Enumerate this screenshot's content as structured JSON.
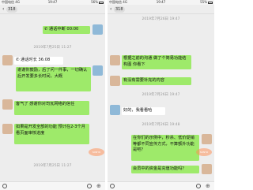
{
  "left": {
    "status": {
      "carrier": "中国电信 4G",
      "time": "19:47",
      "battery": "56%"
    },
    "badge": "318",
    "messages": {
      "call": "通话中断 00:00",
      "ts1": "2019年7月25日 11:27",
      "incall": "通话时长 36:08",
      "m1": "谢谢你鼓励，后了问一件事，一切确认后开发要多长时间，大概",
      "m2": "客气了 感谢你对司瓦网络的信任",
      "m3": "如果是开发全部的功能 预计在2-3个月 看页面审核进度",
      "ts2": "2019年7月25日 11:27"
    }
  },
  "right": {
    "status": {
      "carrier": "中国电信 4G",
      "time": "19:47",
      "battery": "55%"
    },
    "badge": "318",
    "messages": {
      "ts1": "2019年7月26日 19:47",
      "r1": "根据之前的沟通 做了个简易功能结构图 你看下",
      "r2": "有没有需要补充的内容",
      "ts2": "2019年7月26日 19:47",
      "r3": "好的，我看看哈",
      "ts3": "2019年7月26日 19:48",
      "r4": "在你们的示例中，秒杀、低价促销等都不同宣传方式，不算额外功能是吧？",
      "r5": "会员中的资金是充值功能吗？"
    }
  }
}
